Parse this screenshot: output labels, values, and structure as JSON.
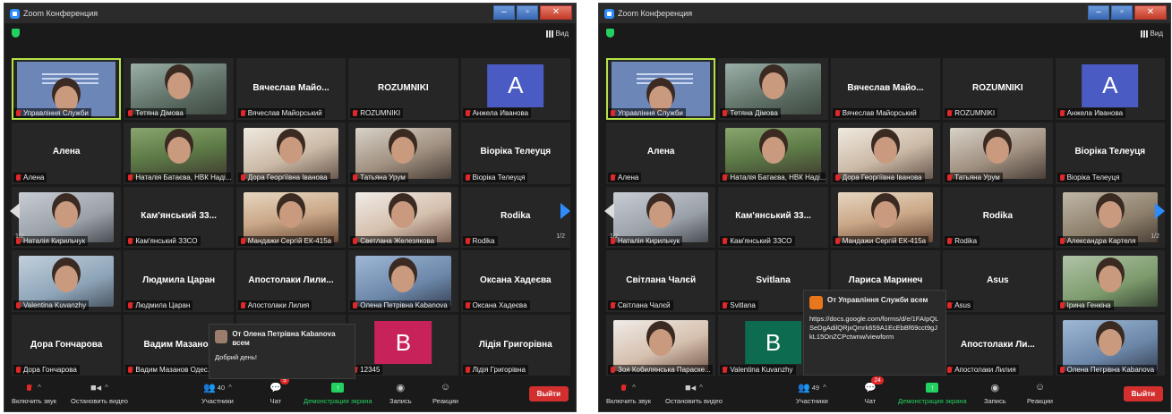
{
  "app": {
    "title": "Zoom Конференция",
    "view_label": "Вид"
  },
  "toolbar": {
    "mute": "Включить звук",
    "video": "Остановить видео",
    "participants": "Участники",
    "chat": "Чат",
    "share": "Демонстрация экрана",
    "record": "Запись",
    "reactions": "Реакции",
    "leave": "Выйти"
  },
  "pager": "1/2",
  "left": {
    "participants_count": "40",
    "chat_badge": "5",
    "popup": {
      "from": "От Олена Петрівна Kabanova всем",
      "message": "Добрий день!"
    },
    "tiles": [
      {
        "label": "Управління Служби",
        "type": "screen"
      },
      {
        "label": "Тетяна Дімова",
        "type": "video",
        "v": "v-a"
      },
      {
        "name": "Вячеслав Майо...",
        "label": "Вячеслав Майорський",
        "type": "name"
      },
      {
        "name": "ROZUMNIKI",
        "label": "ROZUMNIKI",
        "type": "name"
      },
      {
        "label": "Анжела Иванова",
        "type": "avatar",
        "letter": "A",
        "color": "#4a5cc4"
      },
      {
        "name": "Алена",
        "label": "Алена",
        "type": "name"
      },
      {
        "label": "Наталія Батаєва, НВК Наді...",
        "type": "video",
        "v": "v-c"
      },
      {
        "label": "Дора Георгіївна Іванова",
        "type": "video",
        "v": "v-d"
      },
      {
        "label": "Татьяна Урум",
        "type": "video",
        "v": "v-b"
      },
      {
        "name": "Віоріка Телеуця",
        "label": "Віоріка Телеуця",
        "type": "name"
      },
      {
        "label": "Наталія Кирильчук",
        "type": "video",
        "v": "v-e"
      },
      {
        "name": "Кам'янський 33...",
        "label": "Кам'янський ЗЗСО",
        "type": "name"
      },
      {
        "label": "Мандажи Сергій ЕК-415а",
        "type": "video",
        "v": "v-g"
      },
      {
        "label": "Светлана Железякова",
        "type": "video",
        "v": "v-f"
      },
      {
        "name": "Rodika",
        "label": "Rodika",
        "type": "name"
      },
      {
        "label": "Valentina Kuvanzhy",
        "type": "video",
        "v": "v-h"
      },
      {
        "name": "Людмила Царан",
        "label": "Людмила Царан",
        "type": "name"
      },
      {
        "name": "Апостолаки Лили...",
        "label": "Апостолаки Лилия",
        "type": "name"
      },
      {
        "label": "Олена Петрівна Kabanova",
        "type": "video",
        "v": "v-j"
      },
      {
        "name": "Оксана Хадеєва",
        "label": "Оксана Хадеєва",
        "type": "name"
      },
      {
        "name": "Дора Гончарова",
        "label": "Дора Гончарова",
        "type": "name"
      },
      {
        "name": "Вадим Мазанов",
        "label": "Вадим Мазанов Одес...",
        "type": "name"
      },
      {
        "label": "",
        "type": "empty"
      },
      {
        "label": "12345",
        "type": "avatar",
        "letter": "B",
        "color": "#c8225a"
      },
      {
        "name": "Лідія Григорівна",
        "label": "Лідія Григорівна",
        "type": "name"
      }
    ]
  },
  "right": {
    "participants_count": "49",
    "chat_badge": "24",
    "popup": {
      "from": "От Управління Служби всем",
      "message": "https://docs.google.com/forms/d/e/1FAIpQLSeDgAdilQRjxQmrk659A1EcEbBf69cct9gJkL15OnZCPctwnw/viewform"
    },
    "tiles": [
      {
        "label": "Управління Служби",
        "type": "screen"
      },
      {
        "label": "Тетяна Дімова",
        "type": "video",
        "v": "v-a"
      },
      {
        "name": "Вячеслав Майо...",
        "label": "Вячеслав Майорський",
        "type": "name"
      },
      {
        "name": "ROZUMNIKI",
        "label": "ROZUMNIKI",
        "type": "name"
      },
      {
        "label": "Анжела Иванова",
        "type": "avatar",
        "letter": "A",
        "color": "#4a5cc4"
      },
      {
        "name": "Алена",
        "label": "Алена",
        "type": "name"
      },
      {
        "label": "Наталія Батаєва, НВК Наді...",
        "type": "video",
        "v": "v-c"
      },
      {
        "label": "Дора Георгіївна Іванова",
        "type": "video",
        "v": "v-d"
      },
      {
        "label": "Татьяна Урум",
        "type": "video",
        "v": "v-b"
      },
      {
        "name": "Віоріка Телеуця",
        "label": "Віоріка Телеуця",
        "type": "name"
      },
      {
        "label": "Наталія Кирильчук",
        "type": "video",
        "v": "v-e"
      },
      {
        "name": "Кам'янський 33...",
        "label": "Кам'янський ЗЗСО",
        "type": "name"
      },
      {
        "label": "Мандажи Сергій ЕК-415а",
        "type": "video",
        "v": "v-g"
      },
      {
        "name": "Rodika",
        "label": "Rodika",
        "type": "name"
      },
      {
        "label": "Александра Картеля",
        "type": "video",
        "v": "v-k"
      },
      {
        "name": "Світлана Чалєй",
        "label": "Світлана Чалєй",
        "type": "name"
      },
      {
        "name": "Svitlana",
        "label": "Svitlana",
        "type": "name"
      },
      {
        "name": "Лариса Маринеч",
        "label": "",
        "type": "name"
      },
      {
        "name": "Asus",
        "label": "Asus",
        "type": "name"
      },
      {
        "label": "Ірина Генкіна",
        "type": "video",
        "v": "v-i"
      },
      {
        "label": "Зоя Кобилянська Параске...",
        "type": "video",
        "v": "v-f"
      },
      {
        "label": "Valentina Kuvanzhy",
        "type": "avatar",
        "letter": "B",
        "color": "#0d6b4f"
      },
      {
        "label": "",
        "type": "empty"
      },
      {
        "name": "Апостолаки Ли...",
        "label": "Апостолаки Лилия",
        "type": "name"
      },
      {
        "label": "Олена Петрівна Kabanova",
        "type": "video",
        "v": "v-j"
      }
    ]
  }
}
